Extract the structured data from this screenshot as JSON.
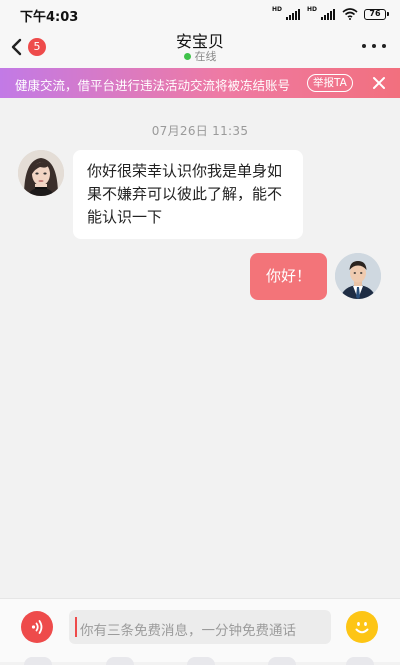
{
  "status_bar": {
    "time": "下午4:03",
    "network_badge_1": "HD",
    "network_badge_2": "HD",
    "battery": "76"
  },
  "header": {
    "unread_count": "5",
    "contact_name": "安宝贝",
    "online_status": "在线"
  },
  "banner": {
    "text": "健康交流，借平台进行违法活动交流将被冻结账号",
    "report_label": "举报TA"
  },
  "chat": {
    "timestamp": "07月26日  11:35",
    "messages": [
      {
        "from": "contact",
        "text": "你好很荣幸认识你我是单身如果不嫌弃可以彼此了解，能不能认识一下"
      },
      {
        "from": "me",
        "text": "你好！"
      }
    ]
  },
  "input_bar": {
    "placeholder": "你有三条免费消息，一分钟免费通话"
  },
  "colors": {
    "accent": "#ee4b4b",
    "outgoing_bubble": "#f37479",
    "online": "#3fc24a",
    "emoji": "#fdc515"
  }
}
